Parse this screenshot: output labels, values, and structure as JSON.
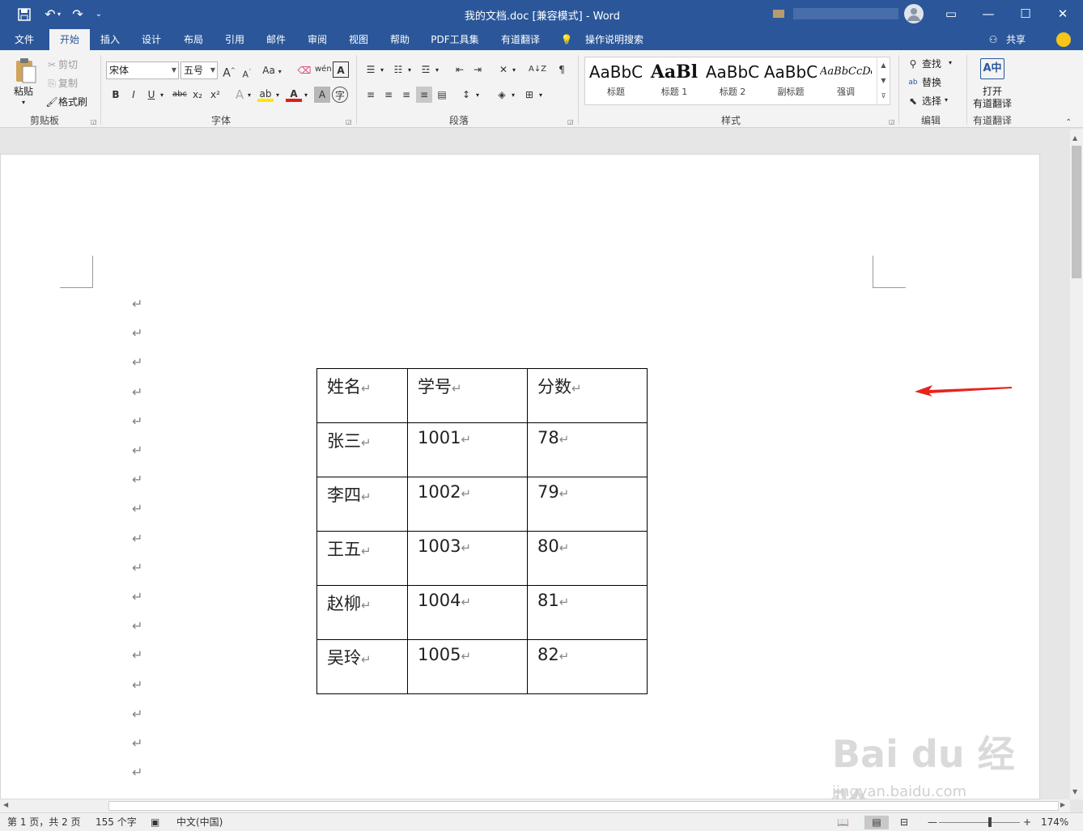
{
  "titlebar": {
    "doc_title": "我的文档.doc [兼容模式]  -  Word",
    "qat": {
      "save": "save-icon",
      "undo": "undo-icon",
      "redo": "redo-icon",
      "customize": "customize-icon"
    },
    "controls": {
      "ribbon_display": "▭",
      "minimize": "—",
      "maximize": "☐",
      "close": "✕"
    }
  },
  "tabs": [
    "文件",
    "开始",
    "插入",
    "设计",
    "布局",
    "引用",
    "邮件",
    "审阅",
    "视图",
    "帮助",
    "PDF工具集",
    "有道翻译"
  ],
  "active_tab": "开始",
  "tell_me": "操作说明搜索",
  "share": "共享",
  "clipboard": {
    "paste": "粘贴",
    "cut": "剪切",
    "copy": "复制",
    "format_painter": "格式刷",
    "label": "剪贴板"
  },
  "font": {
    "name": "宋体",
    "size": "五号",
    "label": "字体",
    "case": "Aa",
    "bold": "B",
    "italic": "I",
    "underline": "U",
    "strike": "abc",
    "sub": "x₂",
    "sup": "x²"
  },
  "paragraph": {
    "label": "段落"
  },
  "styles": {
    "label": "样式",
    "items": [
      {
        "preview": "AaBbC",
        "name": "标题"
      },
      {
        "preview": "AaBl",
        "name": "标题 1"
      },
      {
        "preview": "AaBbC",
        "name": "标题 2"
      },
      {
        "preview": "AaBbC",
        "name": "副标题"
      },
      {
        "preview": "AaBbCcDd",
        "name": "强调"
      }
    ]
  },
  "editing": {
    "find": "查找",
    "replace": "替换",
    "select": "选择",
    "label": "编辑"
  },
  "youdao": {
    "open_line1": "打开",
    "open_line2": "有道翻译",
    "label": "有道翻译"
  },
  "table": {
    "headers": [
      "姓名",
      "学号",
      "分数"
    ],
    "rows": [
      [
        "张三",
        "1001",
        "78"
      ],
      [
        "李四",
        "1002",
        "79"
      ],
      [
        "王五",
        "1003",
        "80"
      ],
      [
        "赵柳",
        "1004",
        "81"
      ],
      [
        "吴玲",
        "1005",
        "82"
      ]
    ]
  },
  "paragraph_mark": "↵",
  "status": {
    "page": "第 1 页，共 2 页",
    "words": "155 个字",
    "language": "中文(中国)",
    "zoom": "174%"
  },
  "watermark": {
    "brand": "Bai du 经验",
    "url": "jingyan.baidu.com"
  },
  "colors": {
    "accent": "#2b579a",
    "arrow": "#e8231b"
  }
}
